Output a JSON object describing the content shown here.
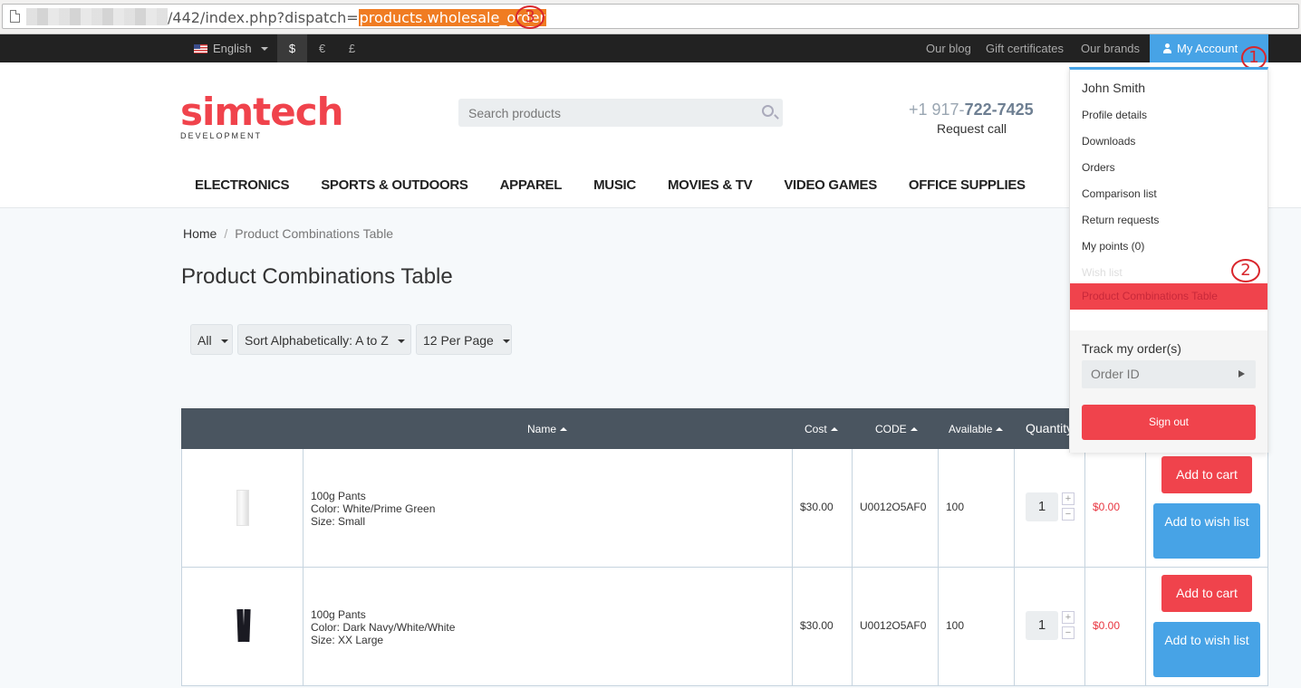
{
  "url": {
    "prefix": "/442/index.php?dispatch=",
    "highlight": "products.wholesale_order"
  },
  "annotations": [
    "1",
    "2",
    "3"
  ],
  "topbar": {
    "language": "English",
    "currencies": [
      "$",
      "€",
      "£"
    ],
    "active_currency": "$",
    "links": [
      "Our blog",
      "Gift certificates",
      "Our brands"
    ],
    "account": "My Account"
  },
  "header": {
    "logo_main": "simtech",
    "logo_sub": "DEVELOPMENT",
    "search_placeholder": "Search products",
    "phone_prefix": "+1 917-",
    "phone_main": "722-7425",
    "request_call": "Request call"
  },
  "nav": [
    "ELECTRONICS",
    "SPORTS & OUTDOORS",
    "APPAREL",
    "MUSIC",
    "MOVIES & TV",
    "VIDEO GAMES",
    "OFFICE SUPPLIES"
  ],
  "breadcrumb": {
    "home": "Home",
    "separator": "/",
    "current": "Product Combinations Table"
  },
  "page_title": "Product Combinations Table",
  "filters": {
    "category": "All",
    "sort": "Sort Alphabetically: A to Z",
    "per_page": "12 Per Page"
  },
  "table": {
    "headers": {
      "name": "Name",
      "cost": "Cost",
      "code": "CODE",
      "available": "Available",
      "quantity": "Quantity"
    },
    "rows": [
      {
        "name": "100g Pants",
        "color": "Color: White/Prime Green",
        "size": "Size: Small",
        "cost": "$30.00",
        "code": "U0012O5AF0",
        "available": "100",
        "qty": "1",
        "total": "$0.00",
        "thumb": "white-pants"
      },
      {
        "name": "100g Pants",
        "color": "Color: Dark Navy/White/White",
        "size": "Size: XX Large",
        "cost": "$30.00",
        "code": "U0012O5AF0",
        "available": "100",
        "qty": "1",
        "total": "$0.00",
        "thumb": "dark-pants"
      }
    ],
    "add_to_cart": "Add to cart",
    "add_to_wish": "Add to wish list",
    "plus": "+",
    "minus": "−"
  },
  "account_menu": {
    "user": "John Smith",
    "items": [
      "Profile details",
      "Downloads",
      "Orders",
      "Comparison list",
      "Return requests",
      "My points (0)",
      "Wish list"
    ],
    "highlighted": "Product Combinations Table",
    "track_label": "Track my order(s)",
    "order_placeholder": "Order ID",
    "sign_out": "Sign out"
  },
  "colors": {
    "brand_red": "#f0434c",
    "accent_blue": "#47a3e6",
    "annotation_red": "#d9262c",
    "url_highlight": "#f07c22"
  }
}
